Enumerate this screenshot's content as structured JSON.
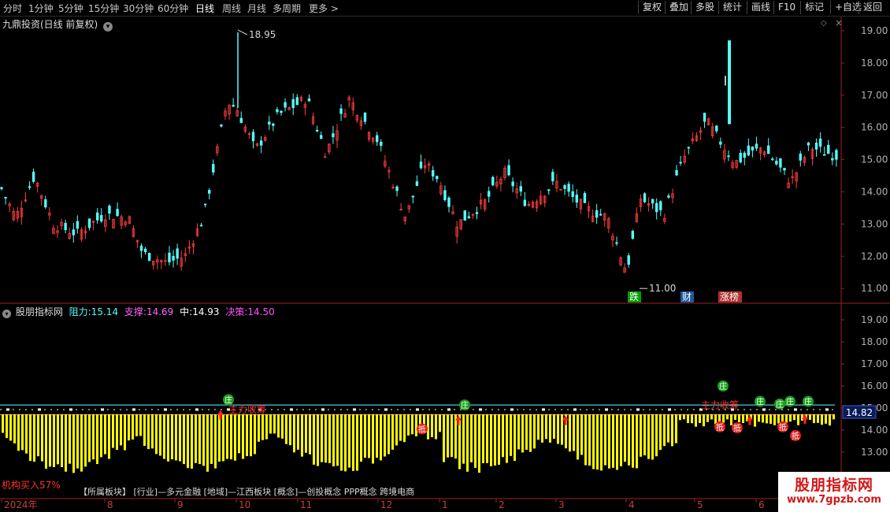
{
  "toolbar": {
    "timeframes": [
      "分时",
      "1分钟",
      "5分钟",
      "15分钟",
      "30分钟",
      "60分钟",
      "日线",
      "周线",
      "月线",
      "多周期",
      "更多 >"
    ],
    "active_timeframe": "日线",
    "right_buttons": [
      "复权",
      "叠加",
      "多股",
      "统计",
      "画线",
      "F10",
      "标记",
      "+自选",
      "返回"
    ]
  },
  "main_chart": {
    "title": "九鼎投资(日线 前复权)",
    "title_icon": "chevron-down-icon",
    "y_ticks": [
      "19.00",
      "18.00",
      "17.00",
      "16.00",
      "15.00",
      "14.00",
      "13.00",
      "12.00",
      "11.00"
    ],
    "high_label": "18.95",
    "low_label": "11.00",
    "markers": [
      "跌",
      "财",
      "涨榜"
    ],
    "marker_colors": [
      "#00a000",
      "#1e5aa0",
      "#b03030"
    ],
    "up_color": "#ff3c3c",
    "down_color": "#54ffff"
  },
  "indicator": {
    "name": "股朋指标网",
    "resist_label": "阻力:",
    "resist_value": "15.14",
    "support_label": "支撑:",
    "support_value": "14.69",
    "mid_label": "中:",
    "mid_value": "14.93",
    "decide_label": "决策:",
    "decide_value": "14.50",
    "y_ticks": [
      "19.00",
      "18.00",
      "17.00",
      "16.00",
      "15.00",
      "14.00",
      "13.00"
    ],
    "current_value": "14.82",
    "bar_color": "#ffff00",
    "zhuang_label": "庄",
    "zhuang_color": "#19a019",
    "dijin_label": "抵",
    "main_label": "主力收筹",
    "inst_buy": "机构买入57%",
    "sector_line": "【所属板块】 [行业]—多元金融 [地域]—江西板块 [概念]—创投概念 PPP概念 跨境电商"
  },
  "x_axis": {
    "labels": [
      "2024年",
      "8",
      "9",
      "10",
      "11",
      "12",
      "1",
      "2",
      "3",
      "4",
      "5",
      "6"
    ]
  },
  "watermark": {
    "title": "股朋指标网",
    "url": "www.7gpzb.com"
  }
}
